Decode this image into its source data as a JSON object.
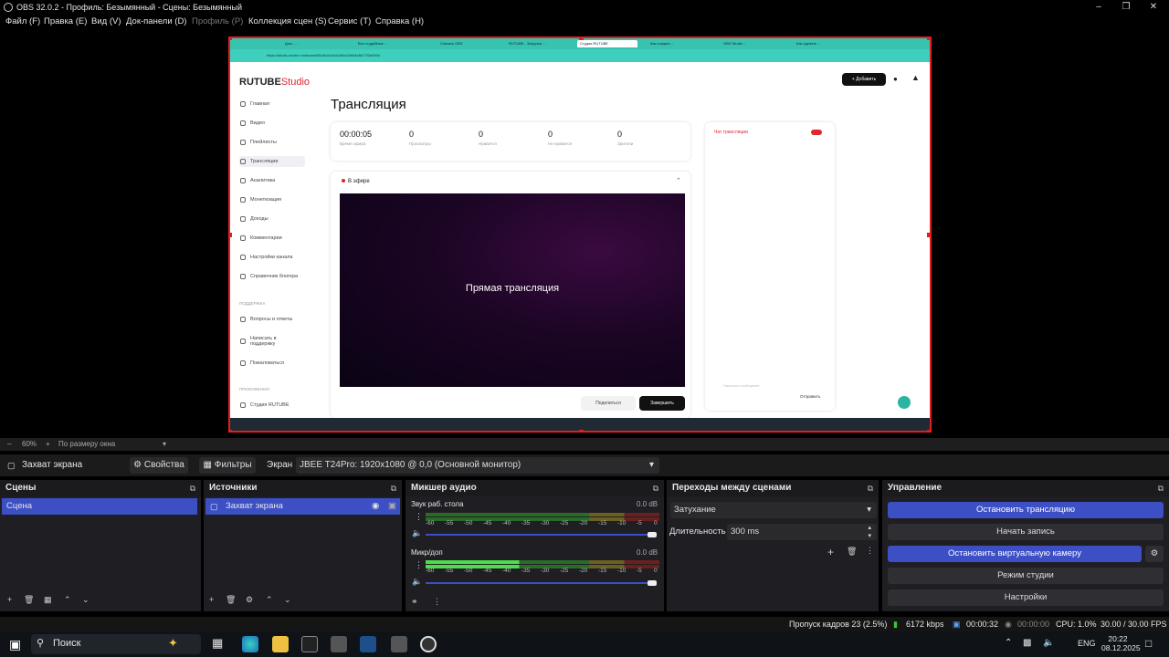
{
  "window": {
    "title": "OBS 32.0.2 - Профиль: Безымянный - Сцены: Безымянный"
  },
  "menu": [
    "Файл (F)",
    "Правка (E)",
    "Вид (V)",
    "Док-панели (D)",
    "Профиль (P)",
    "Коллекция сцен (S)",
    "Сервис (T)",
    "Справка (H)"
  ],
  "browser": {
    "url": "https://studio.rutube.ru/stream/8f0c8c0c9c0c2b5c0b6d4e8d77f3ef2f04",
    "tabs": [
      "Дом - ...",
      "Все студийные ...",
      "Скачать OBS",
      "RUTUBE - Загрузка ...",
      "Студия RUTUBE",
      "Как создать ...",
      "OBS Studio ...",
      "Как сделать ..."
    ]
  },
  "rutube": {
    "logo_main": "RUTUBE",
    "logo_sub": "Studio",
    "add_button": "Добавить",
    "page_title": "Трансляция",
    "nav": [
      "Главная",
      "Видео",
      "Плейлисты",
      "Трансляции",
      "Аналитика",
      "Монетизация",
      "Доходы",
      "Комментарии",
      "Настройки канала",
      "Справочник блогера"
    ],
    "nav_active_index": 3,
    "support_heading": "ПОДДЕРЖКА",
    "support": [
      "Вопросы и ответы",
      "Написать в поддержку",
      "Пожаловаться"
    ],
    "apps_heading": "ПРИЛОЖЕНИЯ",
    "apps": [
      "Студия RUTUBE"
    ],
    "stats": [
      {
        "value": "00:00:05",
        "label": "Время эфира"
      },
      {
        "value": "0",
        "label": "Просмотры"
      },
      {
        "value": "0",
        "label": "Нравится"
      },
      {
        "value": "0",
        "label": "Не нравится"
      },
      {
        "value": "0",
        "label": "Зрители"
      }
    ],
    "live_label": "В эфире",
    "player_caption": "Прямая трансляция",
    "share_button": "Поделиться",
    "end_button": "Завершить",
    "chat_title": "Чат трансляции",
    "chat_send": "Отправить",
    "chat_placeholder": "Написать сообщение"
  },
  "preview_toolbar": {
    "zoom": "60%",
    "fit": "По размеру окна"
  },
  "source_bar": {
    "source_name": "Захват экрана",
    "properties": "Свойства",
    "filters": "Фильтры",
    "screen_label": "Экран",
    "screen_value": "JBEE T24Pro: 1920x1080 @ 0,0 (Основной монитор)"
  },
  "scenes": {
    "title": "Сцены",
    "items": [
      "Сцена"
    ]
  },
  "sources": {
    "title": "Источники",
    "items": [
      "Захват экрана"
    ]
  },
  "mixer": {
    "title": "Микшер аудио",
    "channels": [
      {
        "name": "Звук раб. стола",
        "db": "0.0 dB",
        "level": 0.0
      },
      {
        "name": "Микр/доп",
        "db": "0.0 dB",
        "level": 0.4
      }
    ],
    "scale": [
      "-60",
      "-55",
      "-50",
      "-45",
      "-40",
      "-35",
      "-30",
      "-25",
      "-20",
      "-15",
      "-10",
      "-5",
      "0"
    ]
  },
  "transitions": {
    "title": "Переходы между сценами",
    "type": "Затухание",
    "duration_label": "Длительность",
    "duration": "300 ms"
  },
  "controls": {
    "title": "Управление",
    "buttons": [
      "Остановить трансляцию",
      "Начать запись",
      "Остановить виртуальную камеру",
      "Режим студии",
      "Настройки"
    ]
  },
  "status": {
    "dropped": "Пропуск кадров 23 (2.5%)",
    "bitrate": "6172 kbps",
    "stream_time": "00:00:32",
    "rec_time": "00:00:00",
    "cpu": "CPU: 1.0%",
    "fps": "30.00 / 30.00 FPS"
  },
  "taskbar": {
    "search": "Поиск",
    "lang": "ENG",
    "time": "20:22",
    "date": "08.12.2025"
  },
  "colors": {
    "accent": "#3c4fc4",
    "capture_border": "#e02020",
    "rutube_red": "#e0262e"
  }
}
